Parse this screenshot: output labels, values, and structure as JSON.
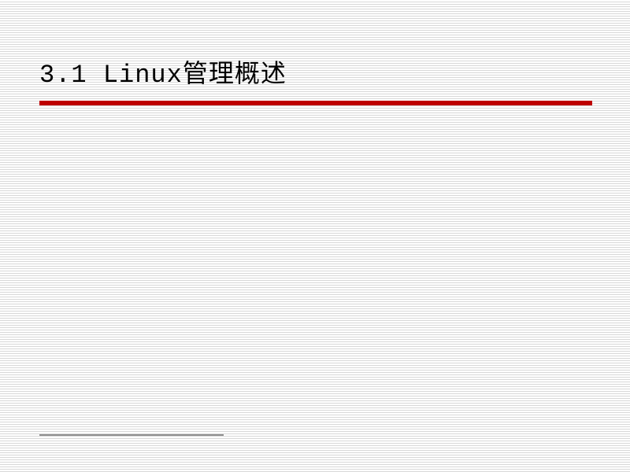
{
  "slide": {
    "title": "3.1 Linux管理概述"
  },
  "colors": {
    "accent": "#be0000",
    "text": "#000000"
  }
}
